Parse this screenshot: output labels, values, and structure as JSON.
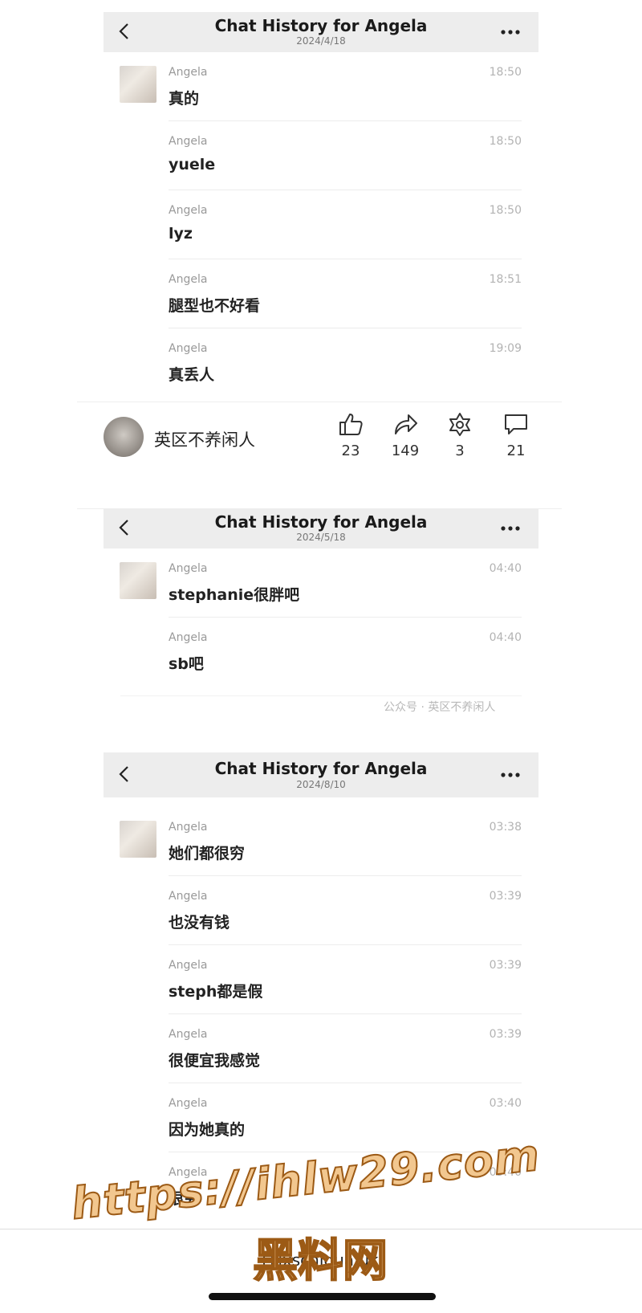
{
  "header": {
    "title": "Chat History for Angela"
  },
  "chat1": {
    "date": "2024/4/18",
    "messages": [
      {
        "name": "Angela",
        "time": "18:50",
        "text": "真的"
      },
      {
        "name": "Angela",
        "time": "18:50",
        "text": "yuele"
      },
      {
        "name": "Angela",
        "time": "18:50",
        "text": "lyz"
      },
      {
        "name": "Angela",
        "time": "18:51",
        "text": "腿型也不好看"
      },
      {
        "name": "Angela",
        "time": "19:09",
        "text": "真丢人"
      }
    ]
  },
  "poster": {
    "name": "英区不养闲人",
    "likes": "23",
    "shares": "149",
    "stars": "3",
    "comments": "21"
  },
  "chat2": {
    "date": "2024/5/18",
    "messages": [
      {
        "name": "Angela",
        "time": "04:40",
        "text": "stephanie很胖吧"
      },
      {
        "name": "Angela",
        "time": "04:40",
        "text": "sb吧"
      }
    ],
    "watermark": "公众号 · 英区不养闲人"
  },
  "chat3": {
    "date": "2024/8/10",
    "messages": [
      {
        "name": "Angela",
        "time": "03:38",
        "text": "她们都很穷"
      },
      {
        "name": "Angela",
        "time": "03:39",
        "text": "也没有钱"
      },
      {
        "name": "Angela",
        "time": "03:39",
        "text": "steph都是假"
      },
      {
        "name": "Angela",
        "time": "03:39",
        "text": "很便宜我感觉"
      },
      {
        "name": "Angela",
        "time": "03:40",
        "text": "因为她真的"
      },
      {
        "name": "Angela",
        "time": "03:40",
        "text": "很穷"
      }
    ]
  },
  "browser": {
    "url": "lxschigua.uk"
  },
  "overlay": {
    "url": "https://ihlw29.com",
    "label": "黑料网"
  }
}
